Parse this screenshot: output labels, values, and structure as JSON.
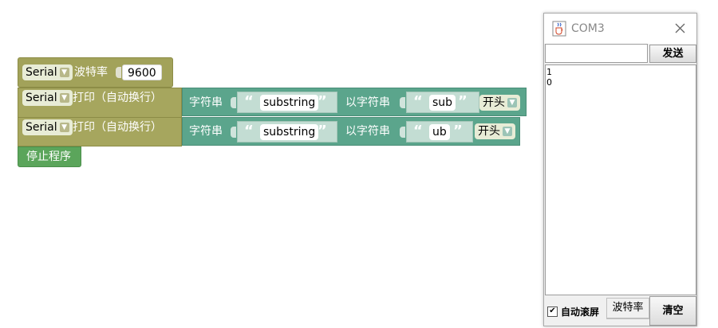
{
  "blocks": {
    "setup": {
      "serial_dropdown": "Serial",
      "baud_label": "波特率",
      "baud_value": "9600"
    },
    "print_rows": [
      {
        "serial_dropdown": "Serial",
        "print_label": "打印（自动换行）",
        "string_label": "字符串",
        "string_value": "substring",
        "startswith_label": "以字符串",
        "prefix_value": "sub",
        "mode_dropdown": "开头"
      },
      {
        "serial_dropdown": "Serial",
        "print_label": "打印（自动换行）",
        "string_label": "字符串",
        "string_value": "substring",
        "startswith_label": "以字符串",
        "prefix_value": "ub",
        "mode_dropdown": "开头"
      }
    ],
    "stop_label": "停止程序"
  },
  "serial_window": {
    "title": "COM3",
    "send_input_value": "",
    "send_button": "发送",
    "output_lines": [
      "1",
      "0"
    ],
    "autoscroll_label": "自动滚屏",
    "autoscroll_checked": true,
    "baud_button": "波特率",
    "baud_partial": "",
    "clear_button": "清空"
  },
  "colors": {
    "serial_block": "#a2a25a",
    "text_block": "#5ba58c",
    "control_block": "#5ba55b"
  }
}
